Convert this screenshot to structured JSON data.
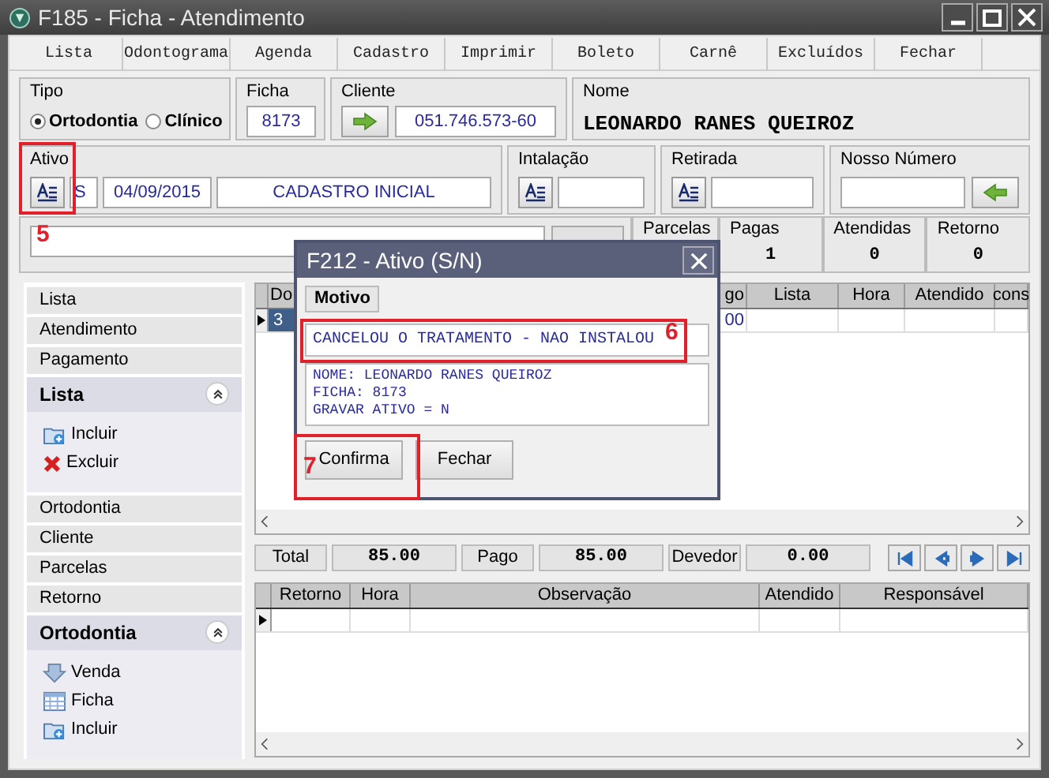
{
  "window": {
    "title": "F185 - Ficha - Atendimento"
  },
  "menu": [
    "Lista",
    "Odontograma",
    "Agenda",
    "Cadastro",
    "Imprimir",
    "Boleto",
    "Carnê",
    "Excluídos",
    "Fechar"
  ],
  "tipo": {
    "label": "Tipo",
    "options": [
      {
        "label": "Ortodontia",
        "selected": true
      },
      {
        "label": "Clínico",
        "selected": false
      }
    ]
  },
  "ficha": {
    "label": "Ficha",
    "value": "8173"
  },
  "cliente": {
    "label": "Cliente",
    "value": "051.746.573-60"
  },
  "nome": {
    "label": "Nome",
    "value": "LEONARDO RANES QUEIROZ"
  },
  "ativo": {
    "label": "Ativo",
    "flag": "S",
    "date": "04/09/2015",
    "description": "CADASTRO INICIAL"
  },
  "instalacao": {
    "label": "Intalação"
  },
  "retirada": {
    "label": "Retirada"
  },
  "nosso_numero": {
    "label": "Nosso Número"
  },
  "stats": [
    {
      "label": "Parcelas"
    },
    {
      "label": "Pagas",
      "value": "1"
    },
    {
      "label": "Atendidas",
      "value": "0"
    },
    {
      "label": "Retorno",
      "value": "0"
    }
  ],
  "sidebar": {
    "items": [
      {
        "kind": "link",
        "label": "Lista"
      },
      {
        "kind": "link",
        "label": "Atendimento"
      },
      {
        "kind": "link",
        "label": "Pagamento"
      },
      {
        "kind": "section",
        "label": "Lista",
        "expanded": true,
        "items": [
          {
            "kind": "add",
            "label": "Incluir"
          },
          {
            "kind": "delete",
            "label": "Excluir"
          }
        ]
      },
      {
        "kind": "link",
        "label": "Ortodontia"
      },
      {
        "kind": "link",
        "label": "Cliente"
      },
      {
        "kind": "link",
        "label": "Parcelas"
      },
      {
        "kind": "link",
        "label": "Retorno"
      },
      {
        "kind": "section",
        "label": "Ortodontia",
        "expanded": true,
        "items": [
          {
            "kind": "down",
            "label": "Venda"
          },
          {
            "kind": "sheet",
            "label": "Ficha"
          },
          {
            "kind": "add",
            "label": "Incluir"
          }
        ]
      }
    ]
  },
  "upper_grid": {
    "columns": [
      "Do",
      "go",
      "Lista",
      "Hora",
      "Atendido",
      "cons"
    ],
    "rows": [
      {
        "selected": true,
        "cells": [
          "3",
          "00"
        ]
      }
    ]
  },
  "totals": [
    {
      "label": "Total",
      "value": "85.00"
    },
    {
      "label": "Pago",
      "value": "85.00"
    },
    {
      "label": "Devedor",
      "value": "0.00"
    }
  ],
  "lower_grid": {
    "columns": [
      "Retorno",
      "Hora",
      "Observação",
      "Atendido",
      "Responsável"
    ]
  },
  "dialog": {
    "title": "F212 - Ativo (S/N)",
    "tab": "Motivo",
    "motivo": "CANCELOU O TRATAMENTO - NAO INSTALOU",
    "details": [
      "NOME: LEONARDO RANES QUEIROZ",
      "FICHA: 8173",
      "GRAVAR ATIVO = N"
    ],
    "buttons": [
      "Confirma",
      "Fechar"
    ]
  },
  "annotations": [
    "5",
    "6",
    "7"
  ]
}
